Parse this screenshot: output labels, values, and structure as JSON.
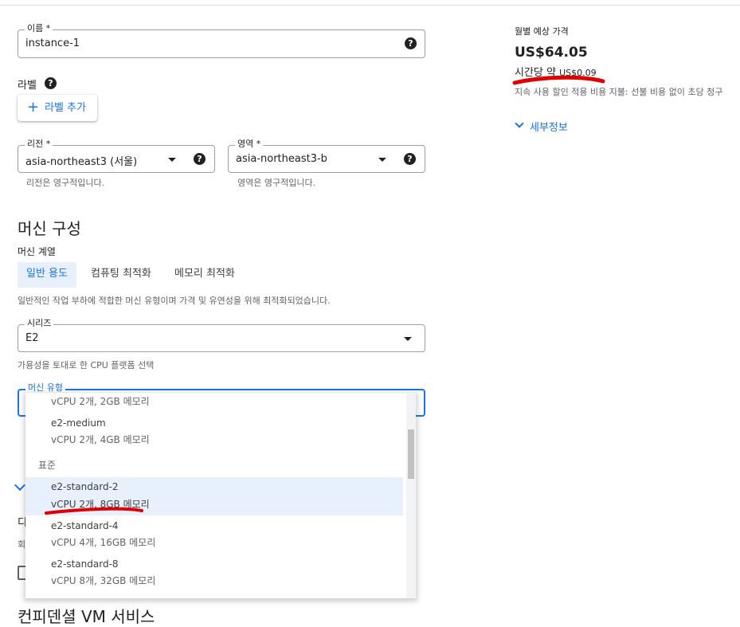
{
  "name_field": {
    "label": "이름 *",
    "value": "instance-1"
  },
  "labels_section": {
    "title": "라벨",
    "add_button": "라벨 추가"
  },
  "region_field": {
    "label": "리전 *",
    "value": "asia-northeast3 (서울)",
    "hint": "리전은 영구적입니다."
  },
  "zone_field": {
    "label": "영역 *",
    "value": "asia-northeast3-b",
    "hint": "영역은 영구적입니다."
  },
  "machine_config": {
    "title": "머신 구성",
    "family_label": "머신 계열",
    "tabs": [
      "일반 용도",
      "컴퓨팅 최적화",
      "메모리 최적화"
    ],
    "family_description": "일반적인 작업 부하에 적합한 머신 유형이며 가격 및 유연성을 위해 최적화되었습니다.",
    "series_label": "시리즈",
    "series_value": "E2",
    "series_hint": "가용성을 토대로 한 CPU 플랫폼 선택",
    "machine_type_label": "머신 유형"
  },
  "machine_type_dropdown": {
    "partial_top_desc": "vCPU 2개, 2GB 메모리",
    "medium": {
      "name": "e2-medium",
      "desc": "vCPU 2개, 4GB 메모리"
    },
    "group_header": "표준",
    "standard_options": [
      {
        "name": "e2-standard-2",
        "desc": "vCPU 2개, 8GB 메모리"
      },
      {
        "name": "e2-standard-4",
        "desc": "vCPU 4개, 16GB 메모리"
      },
      {
        "name": "e2-standard-8",
        "desc": "vCPU 8개, 32GB 메모리"
      }
    ]
  },
  "pricing": {
    "label": "월별 예상 가격",
    "monthly": "US$64.05",
    "hourly_prefix": "시간당 약",
    "hourly_value": "US$0.09",
    "discount_note": "지속 사용 할인 적용 비용 지불: 선불 비용 없이 초당 청구",
    "details_link": "세부정보"
  },
  "behind_dropdown": {
    "char_d": "디",
    "char_h": "회",
    "bottom_title": "컨피덴셜 VM 서비스"
  },
  "colors": {
    "accent": "#1a73e8",
    "annotation_red": "#e00000"
  }
}
